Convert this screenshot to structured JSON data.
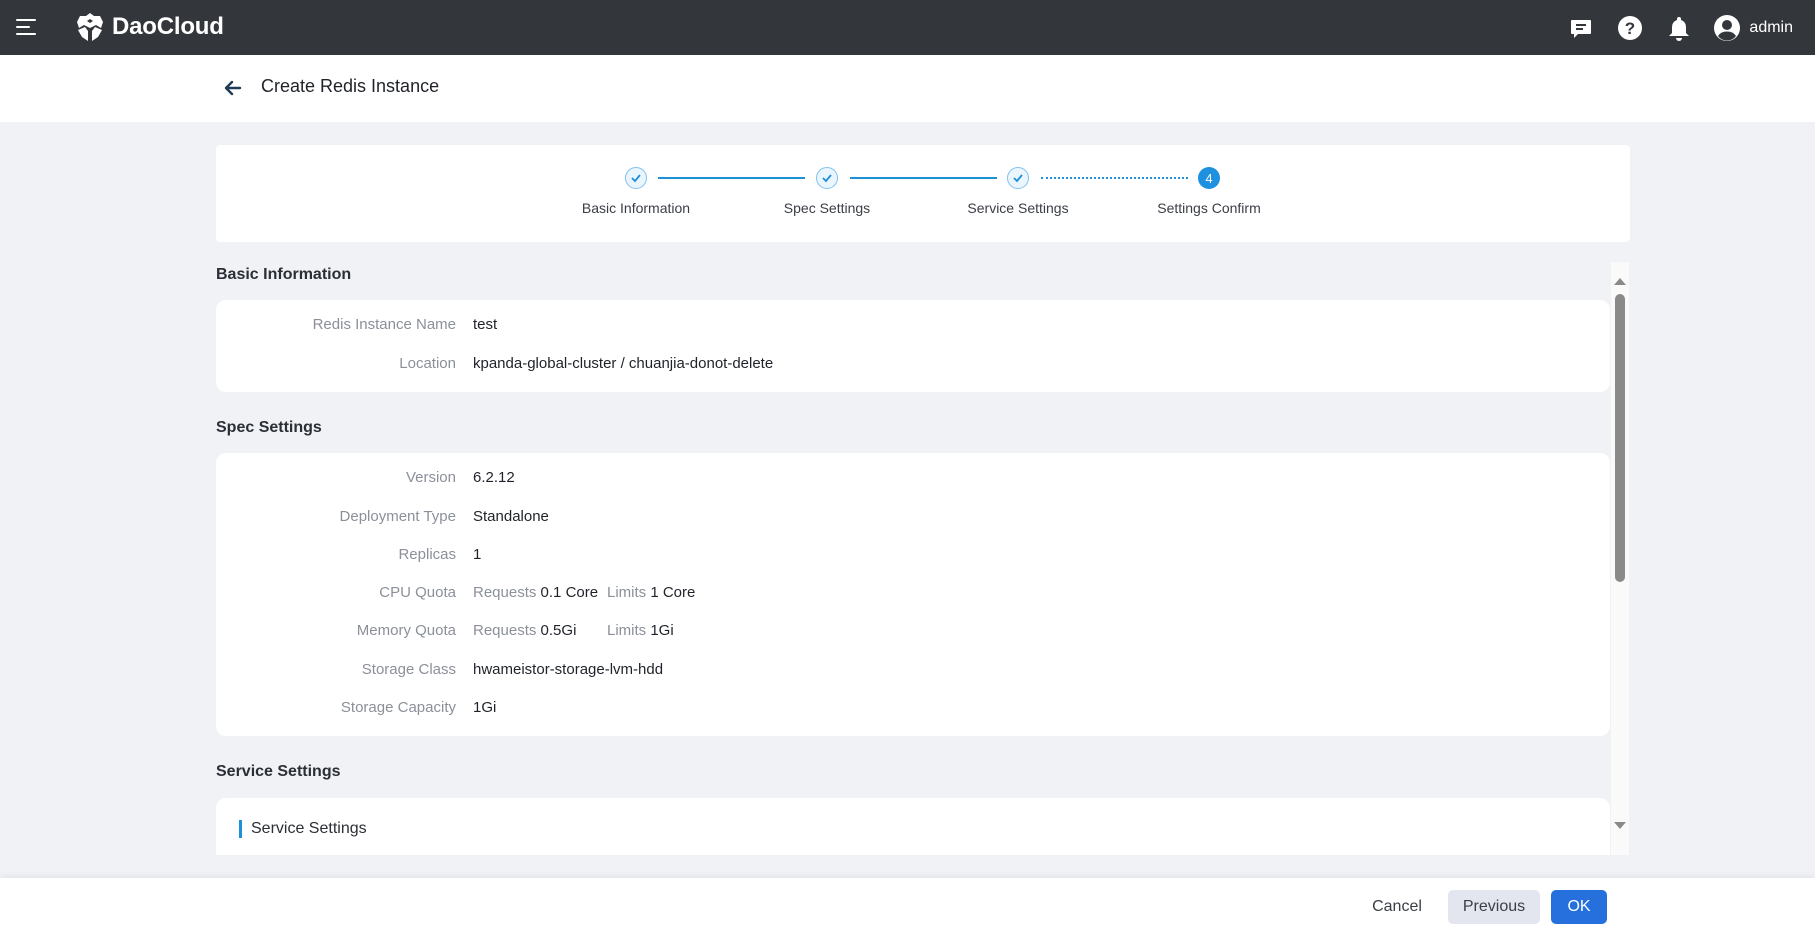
{
  "topbar": {
    "brand": "DaoCloud",
    "icons": [
      "menu-icon",
      "message-icon",
      "help-icon",
      "bell-icon",
      "user-avatar-icon"
    ],
    "user": "admin"
  },
  "header": {
    "title": "Create Redis Instance"
  },
  "stepper": {
    "steps": [
      {
        "label": "Basic Information",
        "status": "done"
      },
      {
        "label": "Spec Settings",
        "status": "done"
      },
      {
        "label": "Service Settings",
        "status": "done"
      },
      {
        "label": "Settings Confirm",
        "status": "active",
        "number": "4"
      }
    ],
    "accent": "#1e8fd9"
  },
  "sections": {
    "basic": {
      "title": "Basic Information",
      "rows": [
        {
          "label": "Redis Instance Name",
          "value": "test"
        },
        {
          "label": "Location",
          "value": "kpanda-global-cluster / chuanjia-donot-delete"
        }
      ]
    },
    "spec": {
      "title": "Spec Settings",
      "rows": [
        {
          "label": "Version",
          "value": "6.2.12"
        },
        {
          "label": "Deployment Type",
          "value": "Standalone"
        },
        {
          "label": "Replicas",
          "value": "1"
        },
        {
          "label": "CPU Quota",
          "requests_label": "Requests",
          "requests": "0.1 Core",
          "limits_label": "Limits",
          "limits": "1 Core"
        },
        {
          "label": "Memory Quota",
          "requests_label": "Requests",
          "requests": "0.5Gi",
          "limits_label": "Limits",
          "limits": "1Gi"
        },
        {
          "label": "Storage Class",
          "value": "hwameistor-storage-lvm-hdd"
        },
        {
          "label": "Storage Capacity",
          "value": "1Gi"
        }
      ]
    },
    "service": {
      "title": "Service Settings",
      "subtitle": "Service Settings"
    }
  },
  "footer": {
    "cancel": "Cancel",
    "previous": "Previous",
    "ok": "OK",
    "primary_color": "#2670de"
  }
}
